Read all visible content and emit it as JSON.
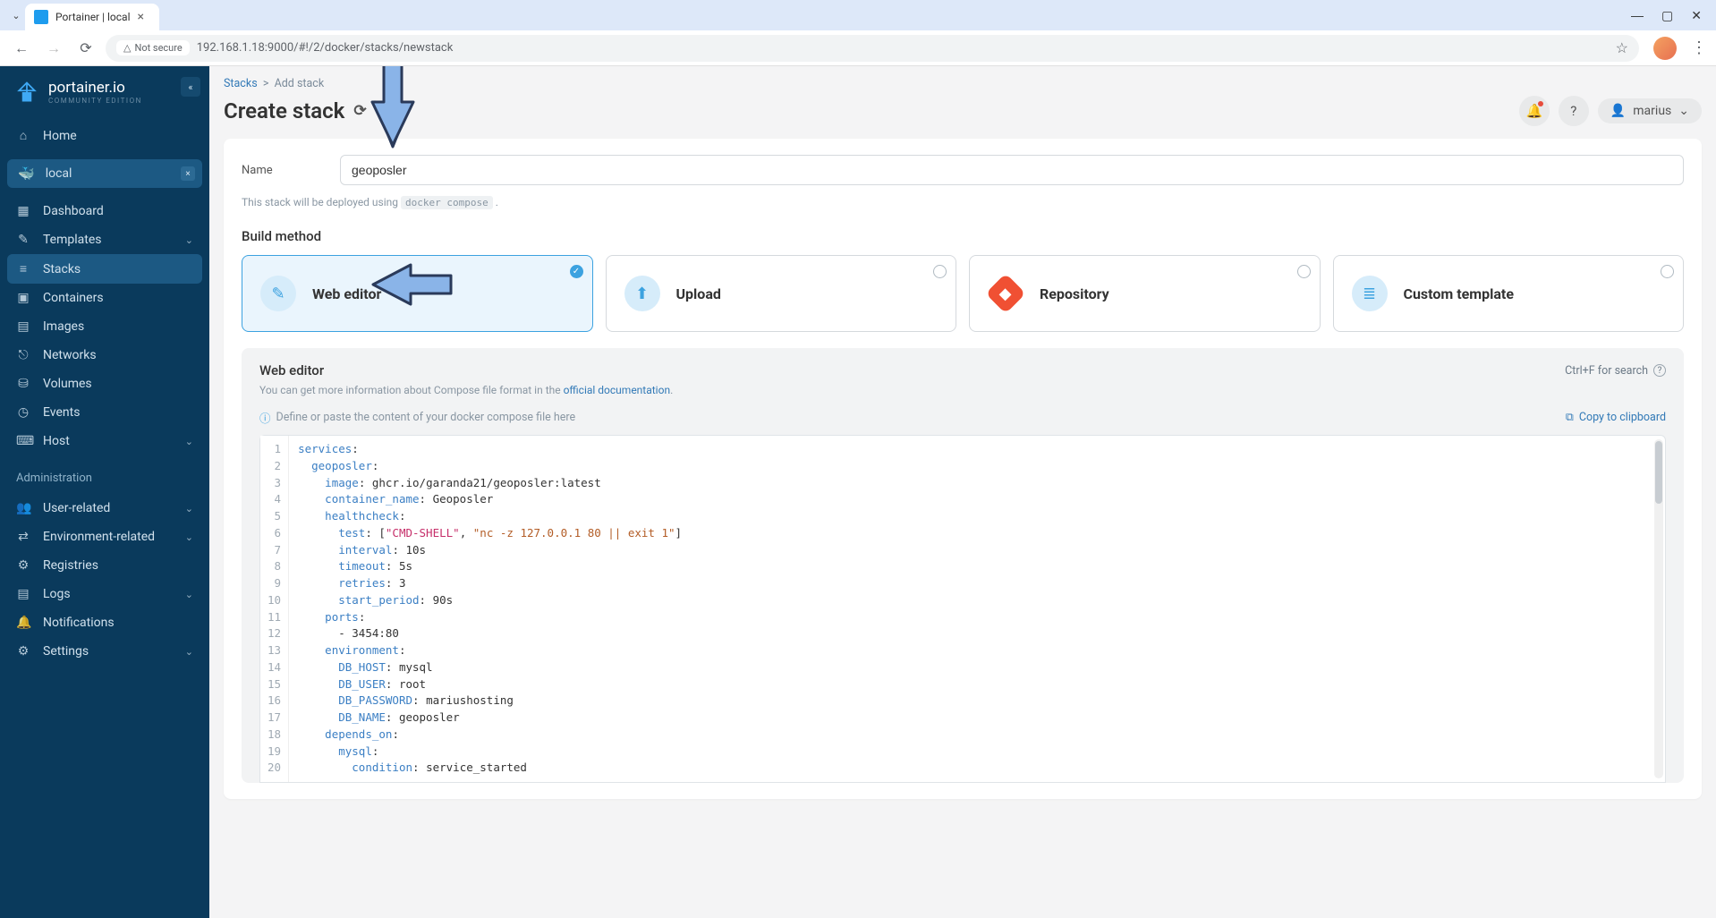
{
  "browser": {
    "tab_title": "Portainer | local",
    "url": "192.168.1.18:9000/#!/2/docker/stacks/newstack",
    "security_label": "Not secure"
  },
  "brand": {
    "name": "portainer.io",
    "edition": "COMMUNITY EDITION"
  },
  "nav": {
    "home": "Home",
    "env_name": "local",
    "items": [
      "Dashboard",
      "Templates",
      "Stacks",
      "Containers",
      "Images",
      "Networks",
      "Volumes",
      "Events",
      "Host"
    ],
    "admin_label": "Administration",
    "admin_items": [
      "User-related",
      "Environment-related",
      "Registries",
      "Logs",
      "Notifications",
      "Settings"
    ]
  },
  "breadcrumb": {
    "root": "Stacks",
    "current": "Add stack"
  },
  "page_title": "Create stack",
  "user": {
    "name": "marius"
  },
  "form": {
    "name_label": "Name",
    "name_value": "geoposler",
    "deploy_prefix": "This stack will be deployed using",
    "deploy_cmd": "docker compose",
    "deploy_suffix": "."
  },
  "build": {
    "title": "Build method",
    "methods": [
      "Web editor",
      "Upload",
      "Repository",
      "Custom template"
    ]
  },
  "editor": {
    "title": "Web editor",
    "search_hint": "Ctrl+F for search",
    "info_prefix": "You can get more information about Compose file format in the",
    "info_link": "official documentation",
    "placeholder_info": "Define or paste the content of your docker compose file here",
    "copy_label": "Copy to clipboard"
  },
  "code": {
    "lines": [
      {
        "n": 1,
        "indent": 0,
        "key": "services",
        "val": ""
      },
      {
        "n": 2,
        "indent": 1,
        "key": "geoposler",
        "val": ""
      },
      {
        "n": 3,
        "indent": 2,
        "key": "image",
        "val": " ghcr.io/garanda21/geoposler:latest"
      },
      {
        "n": 4,
        "indent": 2,
        "key": "container_name",
        "val": " Geoposler"
      },
      {
        "n": 5,
        "indent": 2,
        "key": "healthcheck",
        "val": ""
      },
      {
        "n": 6,
        "indent": 3,
        "key": "test",
        "val": " [\"CMD-SHELL\", \"nc -z 127.0.0.1 80 || exit 1\"]",
        "arr": true
      },
      {
        "n": 7,
        "indent": 3,
        "key": "interval",
        "val": " 10s"
      },
      {
        "n": 8,
        "indent": 3,
        "key": "timeout",
        "val": " 5s"
      },
      {
        "n": 9,
        "indent": 3,
        "key": "retries",
        "val": " 3"
      },
      {
        "n": 10,
        "indent": 3,
        "key": "start_period",
        "val": " 90s"
      },
      {
        "n": 11,
        "indent": 2,
        "key": "ports",
        "val": ""
      },
      {
        "n": 12,
        "indent": 3,
        "raw": "- 3454:80"
      },
      {
        "n": 13,
        "indent": 2,
        "key": "environment",
        "val": ""
      },
      {
        "n": 14,
        "indent": 3,
        "key": "DB_HOST",
        "val": " mysql"
      },
      {
        "n": 15,
        "indent": 3,
        "key": "DB_USER",
        "val": " root"
      },
      {
        "n": 16,
        "indent": 3,
        "key": "DB_PASSWORD",
        "val": " mariushosting"
      },
      {
        "n": 17,
        "indent": 3,
        "key": "DB_NAME",
        "val": " geoposler"
      },
      {
        "n": 18,
        "indent": 2,
        "key": "depends_on",
        "val": ""
      },
      {
        "n": 19,
        "indent": 3,
        "key": "mysql",
        "val": ""
      },
      {
        "n": 20,
        "indent": 4,
        "key": "condition",
        "val": " service_started"
      }
    ]
  }
}
